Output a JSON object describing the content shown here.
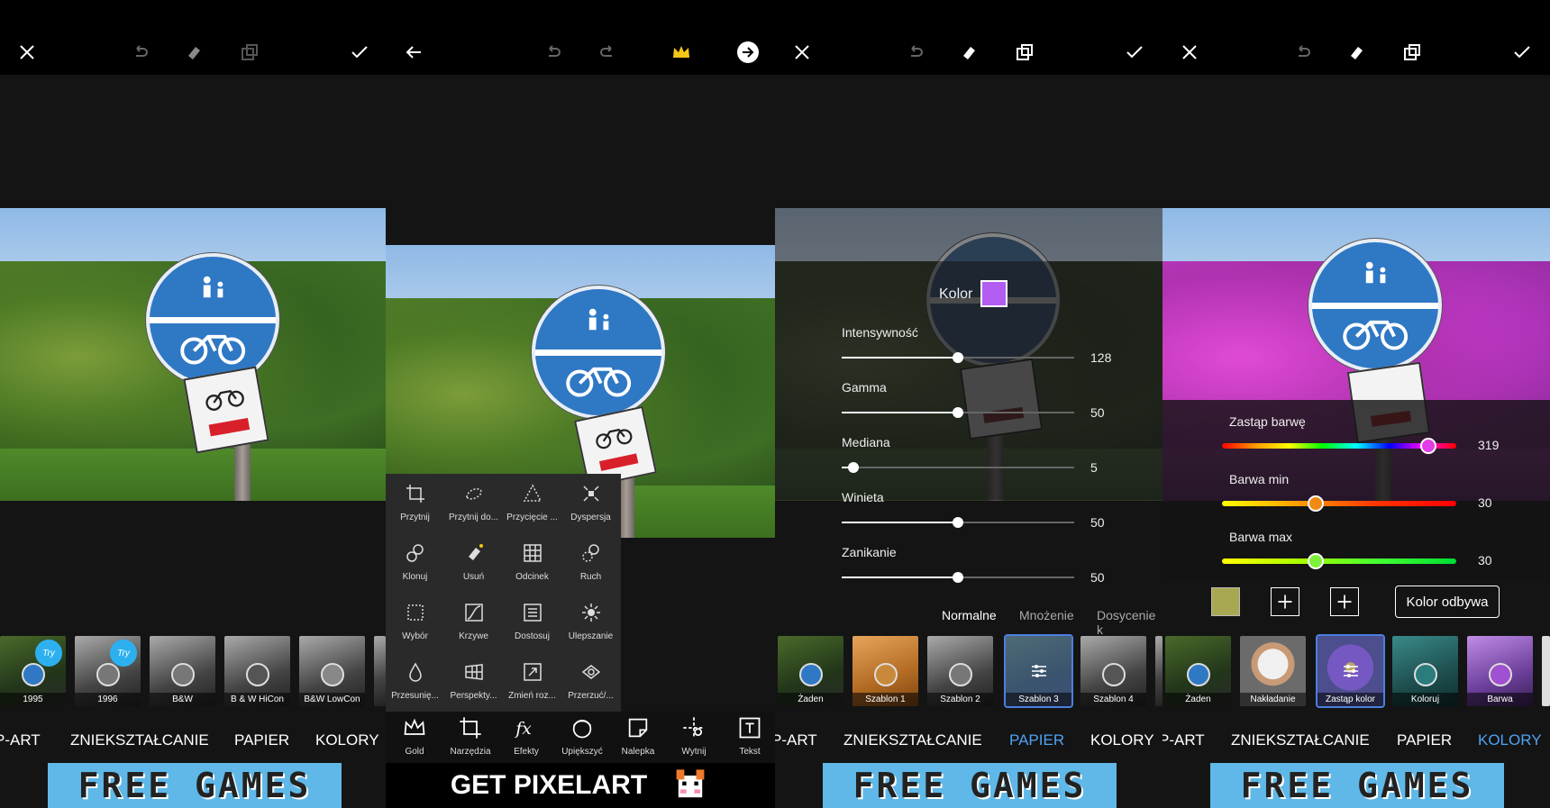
{
  "panel1": {
    "filters": [
      {
        "label": "1995",
        "try": "Try"
      },
      {
        "label": "1996",
        "try": "Try"
      },
      {
        "label": "B&W"
      },
      {
        "label": "B & W HiCon"
      },
      {
        "label": "B&W LowCon"
      }
    ],
    "categories": [
      "P-ART",
      "ZNIEKSZTAŁCANIE",
      "PAPIER",
      "KOLORY"
    ],
    "banner": "FREE GAMES"
  },
  "panel2": {
    "tools": [
      "Przytnij",
      "Przytnij do...",
      "Przycięcie ...",
      "Dyspersja",
      "Klonuj",
      "Usuń",
      "Odcinek",
      "Ruch",
      "Wybór",
      "Krzywe",
      "Dostosuj",
      "Ulepszanie",
      "Przesunię...",
      "Perspekty...",
      "Zmień roz...",
      "Przerzuć/..."
    ],
    "bottom_tools": [
      "Gold",
      "Narzędzia",
      "Efekty",
      "Upiększyć",
      "Nalepka",
      "Wytnij",
      "Tekst"
    ],
    "banner": "GET PIXELART"
  },
  "panel3": {
    "color_label": "Kolor",
    "color_swatch": "#b35cf2",
    "sliders": [
      {
        "label": "Intensywność",
        "value": "128",
        "fraction": 0.5
      },
      {
        "label": "Gamma",
        "value": "50",
        "fraction": 0.5
      },
      {
        "label": "Mediana",
        "value": "5",
        "fraction": 0.05
      },
      {
        "label": "Winieta",
        "value": "50",
        "fraction": 0.5
      },
      {
        "label": "Zanikanie",
        "value": "50",
        "fraction": 0.5
      }
    ],
    "blend_modes": [
      "Normalne",
      "Mnożenie",
      "Dosycenie k"
    ],
    "filters": [
      "Żaden",
      "Szablon 1",
      "Szablon 2",
      "Szablon 3",
      "Szablon 4"
    ],
    "categories": [
      "P-ART",
      "ZNIEKSZTAŁCANIE",
      "PAPIER",
      "KOLORY"
    ],
    "banner": "FREE GAMES"
  },
  "panel4": {
    "sliders": [
      {
        "label": "Zastąp barwę",
        "value": "319",
        "fraction": 0.88,
        "knob_color": "#e23ce6"
      },
      {
        "label": "Barwa min",
        "value": "30",
        "fraction": 0.4,
        "knob_color": "#f08a14"
      },
      {
        "label": "Barwa max",
        "value": "30",
        "fraction": 0.4,
        "knob_color": "#7ef23a"
      }
    ],
    "swatch_color": "#a9a852",
    "button_label": "Kolor odbywa",
    "filters": [
      "Żaden",
      "Nakładanie",
      "Zastąp kolor",
      "Koloruj",
      "Barwa"
    ],
    "categories": [
      "P-ART",
      "ZNIEKSZTAŁCANIE",
      "PAPIER",
      "KOLORY"
    ],
    "banner": "FREE GAMES"
  },
  "colors": {
    "accent": "#4ea2f4",
    "crown": "#f5c518"
  }
}
